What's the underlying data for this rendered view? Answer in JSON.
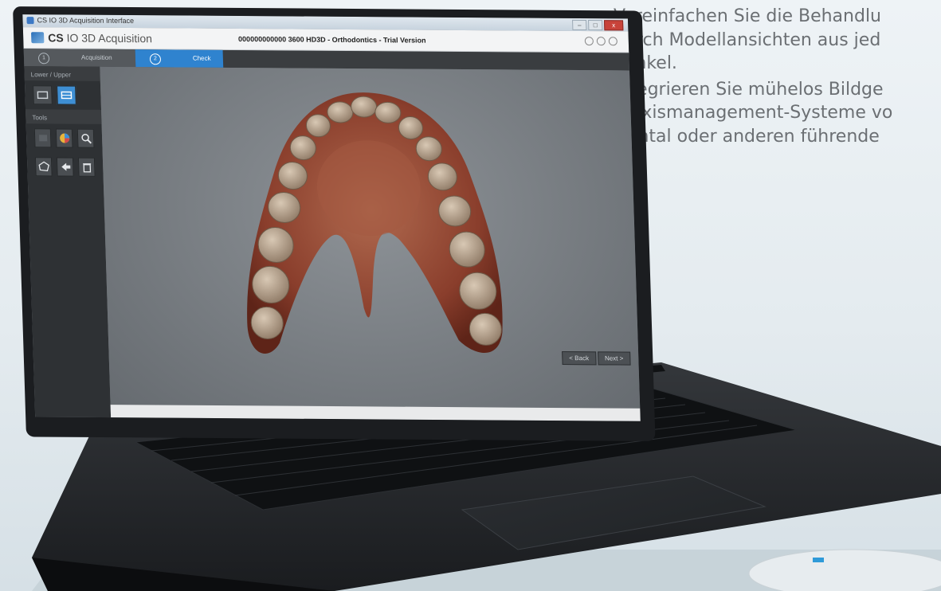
{
  "bullets": [
    {
      "dash": "–",
      "lines": [
        "Vereinfachen Sie die Behandlu",
        "durch Modellansichten aus jed",
        "Winkel."
      ]
    },
    {
      "dash": "–",
      "lines": [
        "Integrieren Sie mühelos Bildge",
        "Praxismanagement-Systeme vo",
        "Dental oder anderen führende"
      ]
    }
  ],
  "window": {
    "title": "CS IO 3D Acquisition Interface",
    "minimize": "–",
    "maximize": "□",
    "close": "x"
  },
  "app": {
    "logo_strong": "CS",
    "logo_rest": "IO 3D Acquisition",
    "document_title": "000000000000 3600 HD3D - Orthodontics - Trial Version"
  },
  "steps": [
    {
      "num": "1",
      "label": "Acquisition"
    },
    {
      "num": "2",
      "label": "Check"
    }
  ],
  "tools": {
    "section_upper_lower": "Lower / Upper",
    "section_tools": "Tools",
    "icons": [
      "lower-jaw-icon",
      "upper-jaw-icon",
      "3d-view-icon",
      "color-icon",
      "zoom-icon",
      "polygon-icon",
      "back-arrow-icon",
      "delete-icon"
    ]
  },
  "nav": {
    "back": "< Back",
    "next": "Next >"
  },
  "colors": {
    "accent": "#2f83cf",
    "dash": "#e08a2e"
  }
}
